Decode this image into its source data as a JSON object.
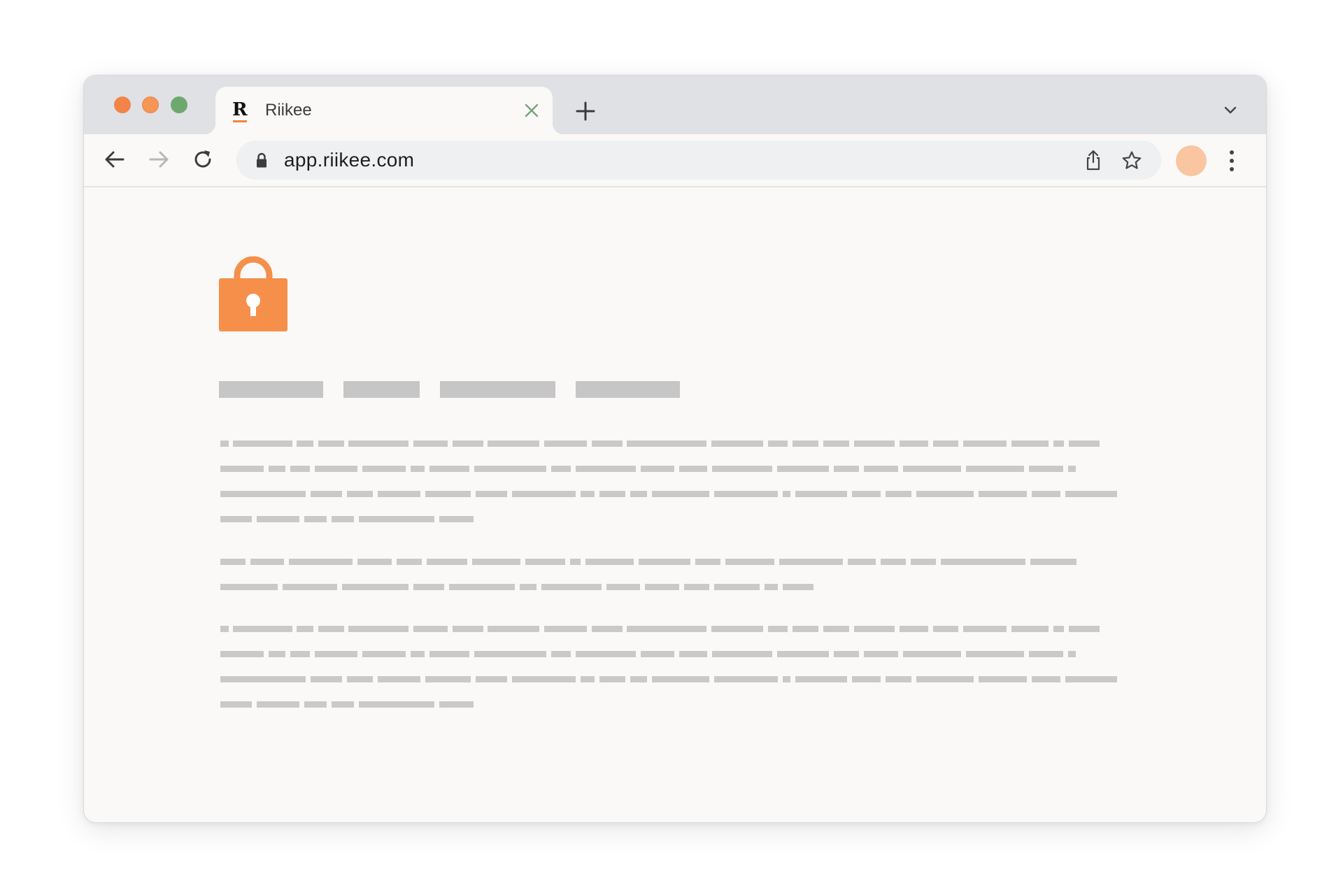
{
  "browser": {
    "traffic_lights": {
      "close_color": "#f28449",
      "minimize_color": "#f59657",
      "maximize_color": "#6fa86e"
    },
    "tab": {
      "favicon_letter": "R",
      "title": "Riikee"
    },
    "address_bar": {
      "url": "app.riikee.com"
    },
    "avatar_color": "#f9c6a1",
    "icons": [
      "back-arrow-icon",
      "forward-arrow-icon",
      "reload-icon",
      "lock-icon",
      "share-icon",
      "star-icon",
      "kebab-menu-icon",
      "new-tab-plus-icon",
      "close-icon",
      "chevron-down-icon"
    ]
  },
  "page": {
    "hero_icon": "padlock-icon",
    "accent_color": "#f58f4a",
    "placeholder_color": "#c9c9c9"
  }
}
